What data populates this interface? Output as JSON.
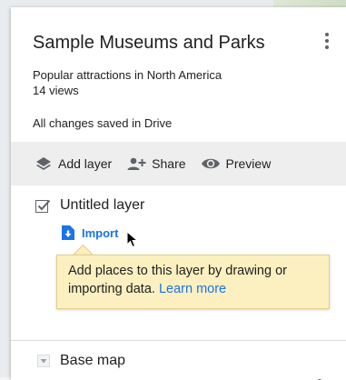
{
  "map": {
    "title": "Sample Museums and Parks",
    "description": "Popular attractions in North America",
    "views": "14 views",
    "save_status": "All changes saved in Drive"
  },
  "toolbar": {
    "add_layer": {
      "label": "Add layer",
      "icon": "layers-icon"
    },
    "share": {
      "label": "Share",
      "icon": "add-person-icon"
    },
    "preview": {
      "label": "Preview",
      "icon": "eye-icon"
    }
  },
  "layer": {
    "checked": true,
    "name": "Untitled layer",
    "import_label": "Import",
    "tip": {
      "text": "Add places to this layer by drawing or importing data.",
      "link": "Learn more"
    }
  },
  "basemap": {
    "label": "Base map",
    "icon": "triangle-down-icon"
  },
  "colors": {
    "link": "#1a73e8",
    "toolbar_bg": "#eeeeee",
    "tip_bg": "#fcf0c0"
  }
}
